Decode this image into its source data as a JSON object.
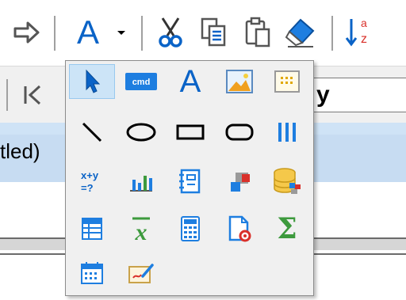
{
  "toolbar": {
    "buttons": [
      {
        "name": "redo",
        "icon": "redo-arrow-icon"
      },
      {
        "name": "text-style",
        "icon": "letter-a-icon",
        "label": "A"
      },
      {
        "name": "dropdown",
        "icon": "chevron-down-icon"
      },
      {
        "name": "cut",
        "icon": "scissors-icon"
      },
      {
        "name": "copy",
        "icon": "copy-icon"
      },
      {
        "name": "paste",
        "icon": "paste-icon"
      },
      {
        "name": "erase",
        "icon": "eraser-icon"
      },
      {
        "name": "sort",
        "icon": "sort-az-icon",
        "label": "a z"
      }
    ]
  },
  "nav": {
    "first_icon": "first-record-icon",
    "combo_text": "y"
  },
  "document": {
    "title": "tled)"
  },
  "palette": {
    "selected_item": "pointer",
    "items": [
      {
        "name": "pointer",
        "icon": "cursor-arrow-icon"
      },
      {
        "name": "command-button",
        "icon": "cmd-button-icon",
        "label": "cmd"
      },
      {
        "name": "text-label",
        "icon": "letter-a-icon",
        "label": "A"
      },
      {
        "name": "image",
        "icon": "image-icon"
      },
      {
        "name": "grid-box",
        "icon": "grid-box-icon"
      },
      {
        "name": "line",
        "icon": "line-icon"
      },
      {
        "name": "ellipse",
        "icon": "ellipse-icon"
      },
      {
        "name": "rectangle",
        "icon": "rectangle-icon"
      },
      {
        "name": "rounded-rectangle",
        "icon": "rounded-rectangle-icon"
      },
      {
        "name": "barcode",
        "icon": "barcode-icon"
      },
      {
        "name": "formula",
        "icon": "formula-icon",
        "label": "x+y =?"
      },
      {
        "name": "chart",
        "icon": "bar-chart-icon"
      },
      {
        "name": "subreport",
        "icon": "subreport-icon"
      },
      {
        "name": "shape",
        "icon": "shapes-icon"
      },
      {
        "name": "database",
        "icon": "database-icon"
      },
      {
        "name": "table",
        "icon": "table-icon"
      },
      {
        "name": "statistics",
        "icon": "mean-x-icon",
        "label": "x"
      },
      {
        "name": "calculator",
        "icon": "calculator-icon"
      },
      {
        "name": "page-settings",
        "icon": "page-gear-icon"
      },
      {
        "name": "summary",
        "icon": "sigma-icon",
        "label": "Σ"
      },
      {
        "name": "calendar",
        "icon": "calendar-icon"
      },
      {
        "name": "signature",
        "icon": "signature-icon"
      }
    ]
  },
  "colors": {
    "accent_blue": "#0a63c7",
    "selection_bg": "#cce4f7",
    "green": "#3d9a3d",
    "red": "#d9302a",
    "orange": "#f0a020"
  }
}
